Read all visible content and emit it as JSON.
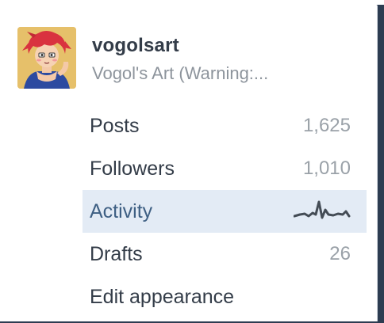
{
  "blog": {
    "name": "vogolsart",
    "title": "Vogol's Art (Warning:..."
  },
  "stats": [
    {
      "label": "Posts",
      "value": "1,625"
    },
    {
      "label": "Followers",
      "value": "1,010"
    },
    {
      "label": "Activity",
      "value": "",
      "icon": "activity-sparkline-icon"
    },
    {
      "label": "Drafts",
      "value": "26"
    },
    {
      "label": "Edit appearance",
      "value": ""
    }
  ],
  "colors": {
    "active_row_bg": "#e3ebf5",
    "active_text": "#3e5f83",
    "text": "#333c48",
    "muted": "#9aa1a8"
  }
}
